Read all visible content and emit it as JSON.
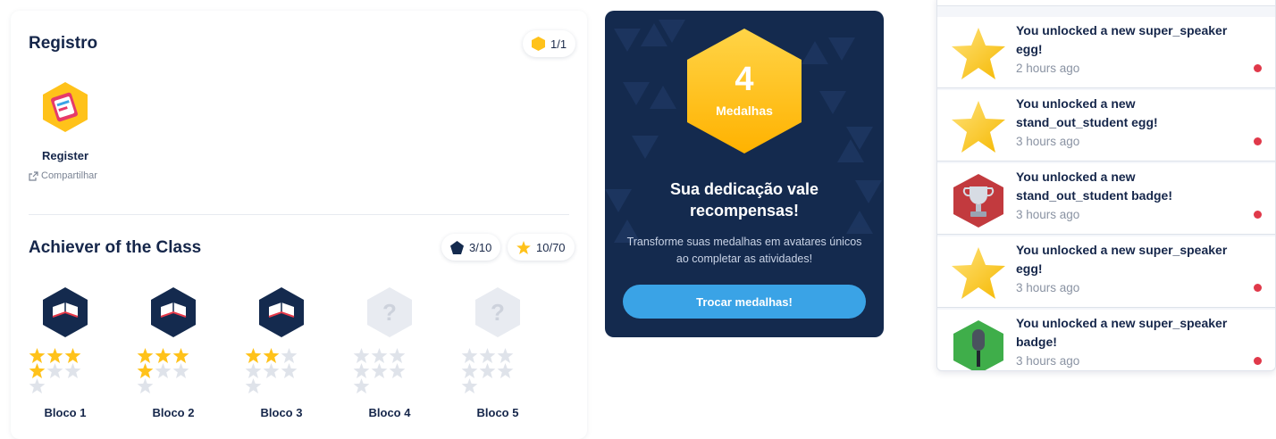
{
  "registro": {
    "title": "Registro",
    "count": "1/1",
    "badge_name": "Register",
    "share_label": "Compartilhar"
  },
  "achiever": {
    "title": "Achiever of the Class",
    "gem_count": "3/10",
    "star_count": "10/70",
    "blocks": [
      {
        "label": "Bloco 1",
        "unlocked": true,
        "stars_filled": 4
      },
      {
        "label": "Bloco 2",
        "unlocked": true,
        "stars_filled": 4
      },
      {
        "label": "Bloco 3",
        "unlocked": true,
        "stars_filled": 2
      },
      {
        "label": "Bloco 4",
        "unlocked": false,
        "stars_filled": 0
      },
      {
        "label": "Bloco 5",
        "unlocked": false,
        "stars_filled": 0
      }
    ]
  },
  "promo": {
    "medal_count": "4",
    "medal_label": "Medalhas",
    "title": "Sua dedicação vale recompensas!",
    "description": "Transforme suas medalhas em avatares únicos ao completar as atividades!",
    "button_label": "Trocar medalhas!"
  },
  "notifications": [
    {
      "icon": "star-icon",
      "message": "You unlocked a new super_speaker egg!",
      "time": "2 hours ago",
      "unread": true
    },
    {
      "icon": "star-icon",
      "message": "You unlocked a new stand_out_student egg!",
      "time": "3 hours ago",
      "unread": true
    },
    {
      "icon": "trophy-icon",
      "message": "You unlocked a new stand_out_student badge!",
      "time": "3 hours ago",
      "unread": true
    },
    {
      "icon": "star-icon",
      "message": "You unlocked a new super_speaker egg!",
      "time": "3 hours ago",
      "unread": true
    },
    {
      "icon": "microphone-icon",
      "message": "You unlocked a new super_speaker badge!",
      "time": "3 hours ago",
      "unread": true
    }
  ],
  "colors": {
    "navy": "#142a4e",
    "accent_blue": "#3aa3e6",
    "gold": "#ffc21a",
    "unread_dot": "#e0394a"
  }
}
